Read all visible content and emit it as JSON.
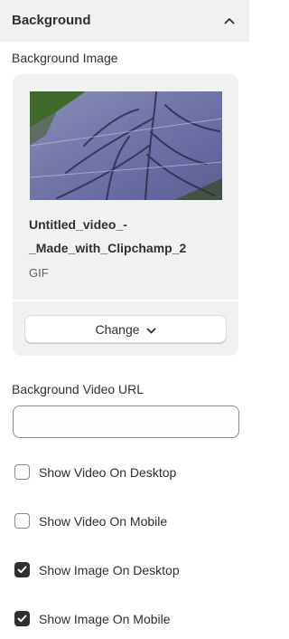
{
  "section": {
    "title": "Background"
  },
  "background_image": {
    "label": "Background Image",
    "file_name": "Untitled_video_-_Made_with_Clipchamp_2",
    "file_type": "GIF",
    "change_label": "Change"
  },
  "background_video": {
    "label": "Background Video URL",
    "value": ""
  },
  "options": [
    {
      "label": "Show Video On Desktop",
      "checked": false
    },
    {
      "label": "Show Video On Mobile",
      "checked": false
    },
    {
      "label": "Show Image On Desktop",
      "checked": true
    },
    {
      "label": "Show Image On Mobile",
      "checked": true
    }
  ],
  "icons": {
    "collapse": "chevron-up-icon",
    "change": "chevron-down-icon",
    "checked": "checkmark-icon"
  },
  "colors": {
    "header_bg": "#f1f1f1",
    "card_bg": "#f1f1f1",
    "checkbox_checked": "#303030",
    "text": "#303030"
  }
}
